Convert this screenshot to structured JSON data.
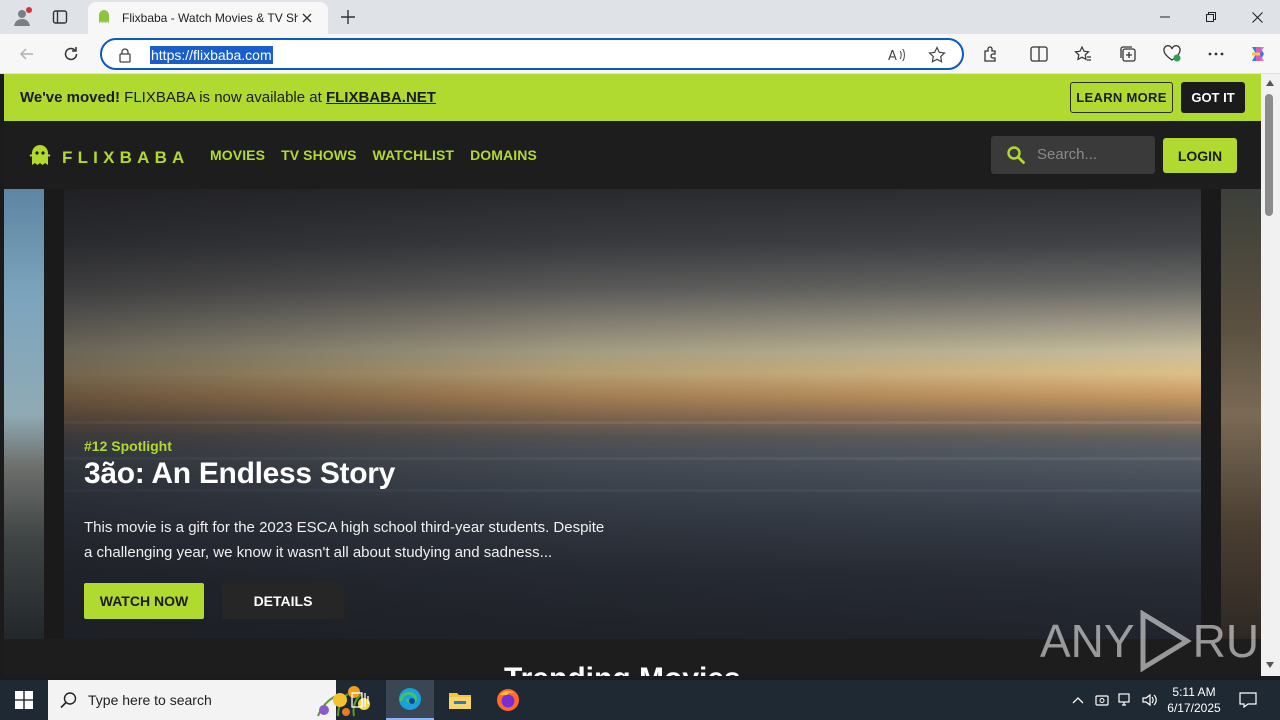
{
  "browser": {
    "tab_title": "Flixbaba - Watch Movies & TV Sh",
    "url": "https://flixbaba.com"
  },
  "notice": {
    "lead": "We've moved!",
    "text": " FLIXBABA is now available at ",
    "link": "FLIXBABA.NET",
    "learn_more": "LEARN MORE",
    "got_it": "GOT IT"
  },
  "header": {
    "logo": "FLIXBABA",
    "nav": [
      "MOVIES",
      "TV SHOWS",
      "WATCHLIST",
      "DOMAINS"
    ],
    "search_placeholder": "Search...",
    "login": "LOGIN"
  },
  "hero": {
    "spotlight": "#12 Spotlight",
    "title": "3ão: An Endless Story",
    "description": "This movie is a gift for the 2023 ESCA high school third-year students. Despite a challenging year, we know it wasn't all about studying and sadness...",
    "watch_now": "WATCH NOW",
    "details": "DETAILS"
  },
  "section": {
    "heading": "Trending Movies"
  },
  "watermark": {
    "text_left": "ANY",
    "text_right": "RUN"
  },
  "taskbar": {
    "search_placeholder": "Type here to search",
    "time": "5:11 AM",
    "date": "6/17/2025"
  },
  "colors": {
    "accent": "#b0da30",
    "header_bg": "#1d1d1d",
    "omnibox_border": "#0c59c2"
  }
}
